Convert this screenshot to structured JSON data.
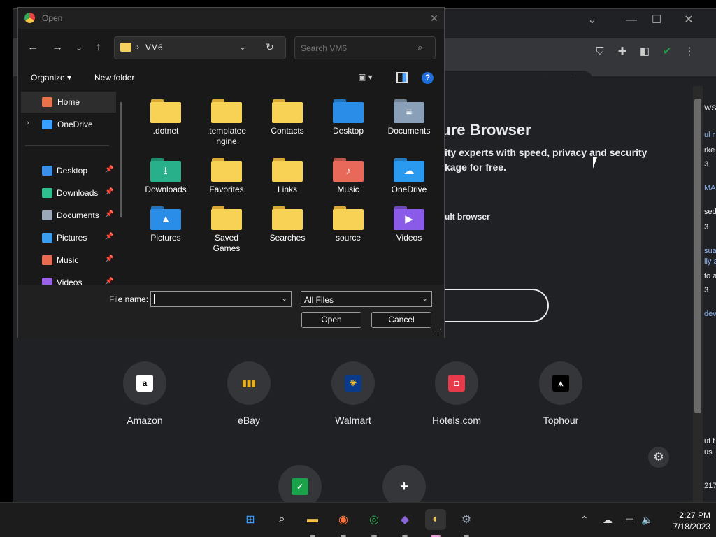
{
  "dialog": {
    "title": "Open",
    "address": {
      "folder": "VM6",
      "separator": "›"
    },
    "search_placeholder": "Search VM6",
    "toolbar": {
      "organize": "Organize ▾",
      "new_folder": "New folder",
      "help": "?"
    },
    "nav_items": [
      {
        "label": "Home",
        "icon": "home-icon",
        "color": "#e8734a",
        "pinned": false,
        "selected": true
      },
      {
        "label": "OneDrive",
        "icon": "onedrive-icon",
        "color": "#3aa0ff",
        "pinned": false,
        "expandable": true
      },
      {
        "label": "Desktop",
        "icon": "desktop-icon",
        "color": "#3a8fe8",
        "pinned": true
      },
      {
        "label": "Downloads",
        "icon": "download-icon",
        "color": "#2fbf8f",
        "pinned": true
      },
      {
        "label": "Documents",
        "icon": "documents-icon",
        "color": "#9aa8b8",
        "pinned": true
      },
      {
        "label": "Pictures",
        "icon": "pictures-icon",
        "color": "#3a9ef0",
        "pinned": true
      },
      {
        "label": "Music",
        "icon": "music-icon",
        "color": "#e86a50",
        "pinned": true
      },
      {
        "label": "Videos",
        "icon": "videos-icon",
        "color": "#9a62e8",
        "pinned": true
      }
    ],
    "files": [
      {
        "name": ".dotnet",
        "type": "folder",
        "emblem": ""
      },
      {
        "name": ".templatee\nngine",
        "type": "folder",
        "emblem": ""
      },
      {
        "name": "Contacts",
        "type": "folder",
        "emblem": ""
      },
      {
        "name": "Desktop",
        "type": "desktop",
        "emblem": ""
      },
      {
        "name": "Documents",
        "type": "documents",
        "emblem": "≡"
      },
      {
        "name": "Downloads",
        "type": "downloads",
        "emblem": "⭳"
      },
      {
        "name": "Favorites",
        "type": "folder",
        "emblem": ""
      },
      {
        "name": "Links",
        "type": "folder",
        "emblem": ""
      },
      {
        "name": "Music",
        "type": "music",
        "emblem": "♪"
      },
      {
        "name": "OneDrive",
        "type": "onedrive",
        "emblem": "☁"
      },
      {
        "name": "Pictures",
        "type": "pictures",
        "emblem": "▲"
      },
      {
        "name": "Saved\nGames",
        "type": "folder",
        "emblem": ""
      },
      {
        "name": "Searches",
        "type": "folder",
        "emblem": ""
      },
      {
        "name": "source",
        "type": "folder",
        "emblem": ""
      },
      {
        "name": "Videos",
        "type": "videos",
        "emblem": "▶"
      }
    ],
    "file_name_label": "File name:",
    "file_name_value": "",
    "file_type": "All Files",
    "open_button": "Open",
    "cancel_button": "Cancel"
  },
  "browser": {
    "heading": "cure Browser",
    "line1": "ity experts with speed, privacy and security",
    "line2": "kage for free.",
    "line3": "ult browser",
    "side_texts": [
      "WS",
      "ul r",
      "rke",
      "3",
      "MA",
      "sed",
      "3",
      "sua",
      "lly a",
      "to a",
      "3",
      "dev",
      "ut t",
      "us",
      "217"
    ],
    "shortcuts": [
      {
        "label": "Amazon",
        "logo": "a",
        "bg": "#ffffff",
        "fg": "#000000"
      },
      {
        "label": "eBay",
        "logo": "▮▮▮",
        "bg": "transparent",
        "fg": "#e8b020"
      },
      {
        "label": "Walmart",
        "logo": "✳",
        "bg": "#0a3a8a",
        "fg": "#ffc220"
      },
      {
        "label": "Hotels.com",
        "logo": "◘",
        "bg": "#e83a4a",
        "fg": "#ffffff"
      },
      {
        "label": "Tophour",
        "logo": "⩚",
        "bg": "#000000",
        "fg": "#ffffff"
      }
    ],
    "bottom_tiles": [
      {
        "logo": "✓",
        "bg": "#1aa34a"
      },
      {
        "logo": "+",
        "bg": "transparent"
      }
    ]
  },
  "taskbar": {
    "apps": [
      {
        "name": "windows-start-icon",
        "glyph": "⊞",
        "color": "#3aa0ff"
      },
      {
        "name": "search-icon",
        "glyph": "⌕",
        "color": "#ffffff"
      },
      {
        "name": "file-explorer-icon",
        "glyph": "▬",
        "color": "#f4c542"
      },
      {
        "name": "firefox-icon",
        "glyph": "◉",
        "color": "#ff7139"
      },
      {
        "name": "chrome-icon",
        "glyph": "◎",
        "color": "#34a853"
      },
      {
        "name": "visual-studio-icon",
        "glyph": "◆",
        "color": "#8a64d8"
      },
      {
        "name": "browser-app-icon",
        "glyph": "◐",
        "color": "#f4c542"
      },
      {
        "name": "settings-icon",
        "glyph": "⚙",
        "color": "#9aa8b8"
      }
    ],
    "time": "2:27 PM",
    "date": "7/18/2023"
  }
}
